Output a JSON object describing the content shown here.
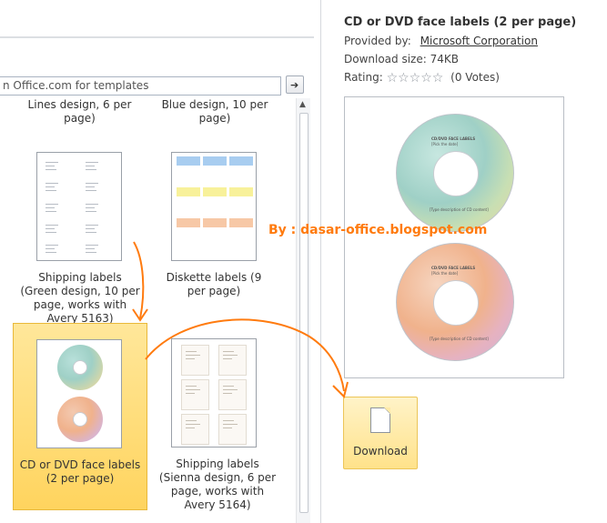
{
  "gallery": {
    "search_placeholder": "n Office.com for templates",
    "go_arrow": "➔",
    "top_labels": [
      "Lines design, 6 per page)",
      "Blue design, 10 per page)"
    ],
    "tiles": [
      {
        "label": "Shipping labels (Green design, 10 per page, works with Avery 5163)"
      },
      {
        "label": "Diskette labels (9 per page)"
      },
      {
        "label": "CD or DVD face labels (2 per page)",
        "selected": true
      },
      {
        "label": "Shipping labels (Sienna design, 6 per page, works with Avery 5164)"
      }
    ],
    "scroll_up": "▲"
  },
  "details": {
    "title": "CD or DVD face labels (2 per page)",
    "provided_by_label": "Provided by:",
    "provider": "Microsoft Corporation",
    "download_size": "Download size: 74KB",
    "rating_label": "Rating:",
    "rating_stars": "☆☆☆☆☆",
    "votes": "(0 Votes)",
    "disc_title": "CD/DVD FACE LABELS",
    "disc_subtitle": "[Pick the date]",
    "disc_caption": "[Type description of CD content]",
    "download_label": "Download"
  },
  "watermark": "By : dasar-office.blogspot.com",
  "colors": {
    "selection": "#ffd45e",
    "annotation": "#ff7b0f",
    "disc_top": "#9fd0c6",
    "disc_bottom": "#f0b28c"
  },
  "icons": [
    "go-arrow-icon",
    "document-icon",
    "star-icon",
    "scroll-up-icon"
  ]
}
